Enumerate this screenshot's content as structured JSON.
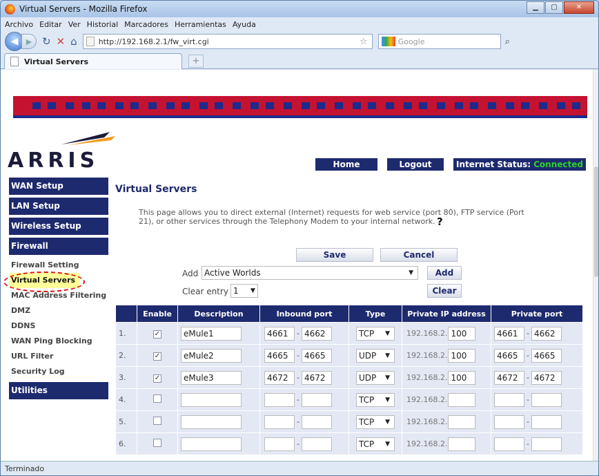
{
  "window": {
    "title": "Virtual Servers - Mozilla Firefox"
  },
  "menu": [
    "Archivo",
    "Editar",
    "Ver",
    "Historial",
    "Marcadores",
    "Herramientas",
    "Ayuda"
  ],
  "nav": {
    "url": "http://192.168.2.1/fw_virt.cgi",
    "search_placeholder": "Google",
    "tab_title": "Virtual Servers"
  },
  "status": "Terminado",
  "brand": {
    "logo": "ARRIS",
    "home": "Home",
    "logout": "Logout",
    "internet_label": "Internet Status:",
    "internet_value": "Connected"
  },
  "sidebar": {
    "wan": "WAN Setup",
    "lan": "LAN Setup",
    "wireless": "Wireless Setup",
    "firewall": "Firewall",
    "items": [
      "Firewall Setting",
      "Virtual Servers",
      "MAC Address Filtering",
      "DMZ",
      "DDNS",
      "WAN Ping Blocking",
      "URL Filter",
      "Security Log"
    ],
    "utilities": "Utilities"
  },
  "page": {
    "title": "Virtual Servers",
    "description": "This page allows you to direct external (Internet) requests for web service (port 80), FTP service (Port 21), or other services through the Telephony Modem to your internal network.",
    "help": "?",
    "save": "Save",
    "cancel": "Cancel",
    "add_label": "Add",
    "add_selected": "Active Worlds",
    "add_btn": "Add",
    "clear_label": "Clear entry",
    "clear_selected": "1",
    "clear_btn": "Clear"
  },
  "table": {
    "headers": [
      "",
      "Enable",
      "Description",
      "Inbound port",
      "Type",
      "Private IP address",
      "Private port"
    ],
    "ip_prefix": "192.168.2.",
    "rows": [
      {
        "num": "1.",
        "enabled": true,
        "desc": "eMule1",
        "in_start": "4661",
        "in_end": "4662",
        "type": "TCP",
        "ip": "100",
        "p_start": "4661",
        "p_end": "4662"
      },
      {
        "num": "2.",
        "enabled": true,
        "desc": "eMule2",
        "in_start": "4665",
        "in_end": "4665",
        "type": "UDP",
        "ip": "100",
        "p_start": "4665",
        "p_end": "4665"
      },
      {
        "num": "3.",
        "enabled": true,
        "desc": "eMule3",
        "in_start": "4672",
        "in_end": "4672",
        "type": "UDP",
        "ip": "100",
        "p_start": "4672",
        "p_end": "4672"
      },
      {
        "num": "4.",
        "enabled": false,
        "desc": "",
        "in_start": "",
        "in_end": "",
        "type": "TCP",
        "ip": "",
        "p_start": "",
        "p_end": ""
      },
      {
        "num": "5.",
        "enabled": false,
        "desc": "",
        "in_start": "",
        "in_end": "",
        "type": "TCP",
        "ip": "",
        "p_start": "",
        "p_end": ""
      },
      {
        "num": "6.",
        "enabled": false,
        "desc": "",
        "in_start": "",
        "in_end": "",
        "type": "TCP",
        "ip": "",
        "p_start": "",
        "p_end": ""
      }
    ]
  }
}
